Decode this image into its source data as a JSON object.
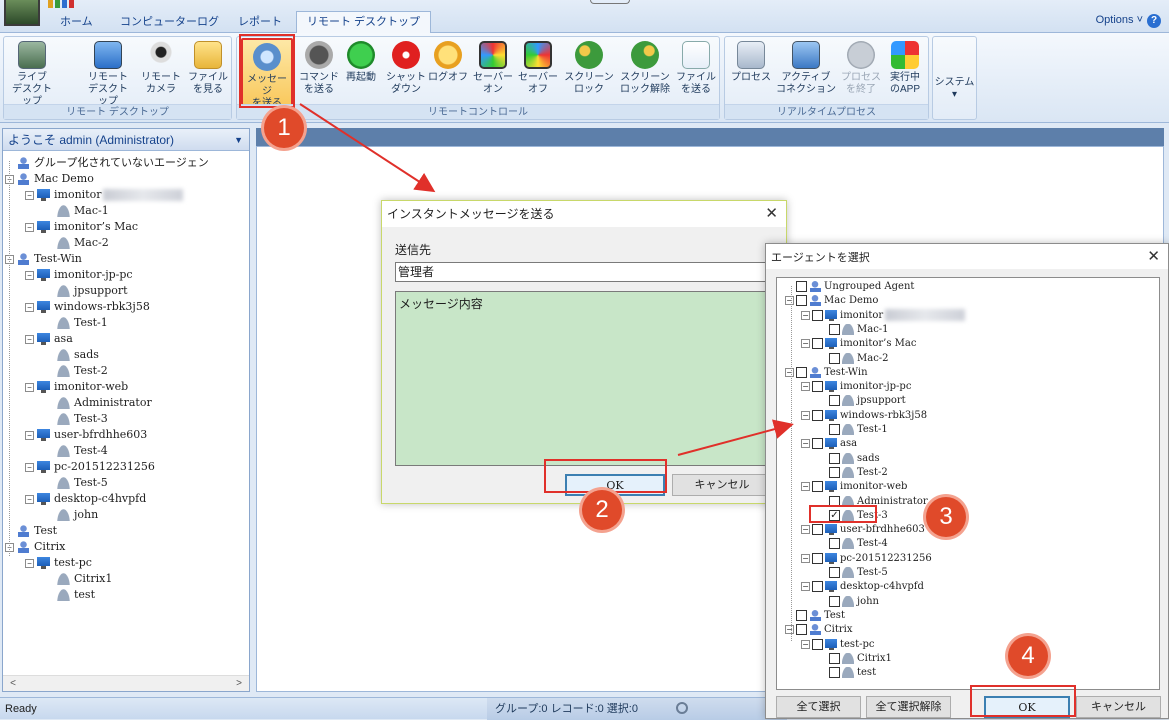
{
  "ribbon": {
    "tabs": [
      "ホーム",
      "コンピューターログ",
      "レポート",
      "リモート デスクトップ"
    ],
    "active_tab": "リモート デスクトップ",
    "options_label": "Options ˅",
    "groups": {
      "remote_desktop": "リモート デスクトップ",
      "remote_control": "リモートコントロール",
      "realtime_process": "リアルタイムプロセス"
    },
    "buttons": {
      "live_desktop": "ライブ\nデスクトップ",
      "remote_desktop": "リモート\nデスクトップ",
      "remote_camera": "リモート\nカメラ",
      "view_file": "ファイル\nを見る",
      "send_message": "メッセージ\nを送る",
      "send_command": "コマンド\nを送る",
      "restart": "再起動",
      "shutdown": "シャット\nダウン",
      "logoff": "ログオフ",
      "server_on": "セーバー\nオン",
      "server_off": "セーバー\nオフ",
      "screen_lock": "スクリーン\nロック",
      "screen_unlock": "スクリーン\nロック解除",
      "send_file": "ファイル\nを送る",
      "process": "プロセス",
      "active_connection": "アクティブ\nコネクション",
      "end_process": "プロセス\nを終了",
      "running_app": "実行中\nのAPP",
      "system": "システム"
    }
  },
  "left_panel": {
    "header": "ようこそ admin (Administrator)",
    "tree": [
      {
        "label": "グループ化されていないエージェン",
        "type": "group",
        "level": 0
      },
      {
        "label": "Mac Demo",
        "type": "group",
        "level": 0
      },
      {
        "label": "imonitor",
        "type": "pc",
        "level": 1,
        "blurred": true
      },
      {
        "label": "Mac-1",
        "type": "user",
        "level": 2
      },
      {
        "label": "imonitor’s Mac",
        "type": "pc",
        "level": 1
      },
      {
        "label": "Mac-2",
        "type": "user",
        "level": 2
      },
      {
        "label": "Test-Win",
        "type": "group",
        "level": 0
      },
      {
        "label": "imonitor-jp-pc",
        "type": "pc",
        "level": 1
      },
      {
        "label": "jpsupport",
        "type": "user",
        "level": 2
      },
      {
        "label": "windows-rbk3j58",
        "type": "pc",
        "level": 1
      },
      {
        "label": "Test-1",
        "type": "user",
        "level": 2
      },
      {
        "label": "asa",
        "type": "pc",
        "level": 1
      },
      {
        "label": "sads",
        "type": "user",
        "level": 2
      },
      {
        "label": "Test-2",
        "type": "user",
        "level": 2
      },
      {
        "label": "imonitor-web",
        "type": "pc",
        "level": 1
      },
      {
        "label": "Administrator",
        "type": "user",
        "level": 2
      },
      {
        "label": "Test-3",
        "type": "user",
        "level": 2
      },
      {
        "label": "user-bfrdhhe603",
        "type": "pc",
        "level": 1
      },
      {
        "label": "Test-4",
        "type": "user",
        "level": 2
      },
      {
        "label": "pc-201512231256",
        "type": "pc",
        "level": 1
      },
      {
        "label": "Test-5",
        "type": "user",
        "level": 2
      },
      {
        "label": "desktop-c4hvpfd",
        "type": "pc",
        "level": 1
      },
      {
        "label": "john",
        "type": "user",
        "level": 2
      },
      {
        "label": "Test",
        "type": "group",
        "level": 0
      },
      {
        "label": "Citrix",
        "type": "group",
        "level": 0
      },
      {
        "label": "test-pc",
        "type": "pc",
        "level": 1
      },
      {
        "label": "Citrix1",
        "type": "user",
        "level": 2
      },
      {
        "label": "test",
        "type": "user",
        "level": 2
      }
    ]
  },
  "status": {
    "ready": "Ready",
    "counts": "グループ:0 レコード:0 選択:0"
  },
  "message_dialog": {
    "title": "インスタントメッセージを送る",
    "to_label": "送信先",
    "to_value": "管理者",
    "message_value": "メッセージ内容",
    "ok": "OK",
    "cancel": "キャンセル"
  },
  "agent_dialog": {
    "title": "エージェントを選択",
    "select_all": "全て選択",
    "deselect_all": "全て選択解除",
    "ok": "OK",
    "cancel": "キャンセル",
    "tree": [
      {
        "label": "Ungrouped Agent",
        "type": "group",
        "level": 0,
        "checked": false
      },
      {
        "label": "Mac Demo",
        "type": "group",
        "level": 0,
        "checked": false
      },
      {
        "label": "imonitor",
        "type": "pc",
        "level": 1,
        "checked": false,
        "blurred": true
      },
      {
        "label": "Mac-1",
        "type": "user",
        "level": 2,
        "checked": false
      },
      {
        "label": "imonitor’s Mac",
        "type": "pc",
        "level": 1,
        "checked": false
      },
      {
        "label": "Mac-2",
        "type": "user",
        "level": 2,
        "checked": false
      },
      {
        "label": "Test-Win",
        "type": "group",
        "level": 0,
        "checked": false
      },
      {
        "label": "imonitor-jp-pc",
        "type": "pc",
        "level": 1,
        "checked": false
      },
      {
        "label": "jpsupport",
        "type": "user",
        "level": 2,
        "checked": false
      },
      {
        "label": "windows-rbk3j58",
        "type": "pc",
        "level": 1,
        "checked": false
      },
      {
        "label": "Test-1",
        "type": "user",
        "level": 2,
        "checked": false
      },
      {
        "label": "asa",
        "type": "pc",
        "level": 1,
        "checked": false
      },
      {
        "label": "sads",
        "type": "user",
        "level": 2,
        "checked": false
      },
      {
        "label": "Test-2",
        "type": "user",
        "level": 2,
        "checked": false
      },
      {
        "label": "imonitor-web",
        "type": "pc",
        "level": 1,
        "checked": false
      },
      {
        "label": "Administrator",
        "type": "user",
        "level": 2,
        "checked": false
      },
      {
        "label": "Test-3",
        "type": "user",
        "level": 2,
        "checked": true
      },
      {
        "label": "user-bfrdhhe603",
        "type": "pc",
        "level": 1,
        "checked": false
      },
      {
        "label": "Test-4",
        "type": "user",
        "level": 2,
        "checked": false
      },
      {
        "label": "pc-201512231256",
        "type": "pc",
        "level": 1,
        "checked": false
      },
      {
        "label": "Test-5",
        "type": "user",
        "level": 2,
        "checked": false
      },
      {
        "label": "desktop-c4hvpfd",
        "type": "pc",
        "level": 1,
        "checked": false
      },
      {
        "label": "john",
        "type": "user",
        "level": 2,
        "checked": false
      },
      {
        "label": "Test",
        "type": "group",
        "level": 0,
        "checked": false
      },
      {
        "label": "Citrix",
        "type": "group",
        "level": 0,
        "checked": false
      },
      {
        "label": "test-pc",
        "type": "pc",
        "level": 1,
        "checked": false
      },
      {
        "label": "Citrix1",
        "type": "user",
        "level": 2,
        "checked": false
      },
      {
        "label": "test",
        "type": "user",
        "level": 2,
        "checked": false
      }
    ]
  },
  "annotations": {
    "step1": "1",
    "step2": "2",
    "step3": "3",
    "step4": "4",
    "color": "#e0302a"
  }
}
